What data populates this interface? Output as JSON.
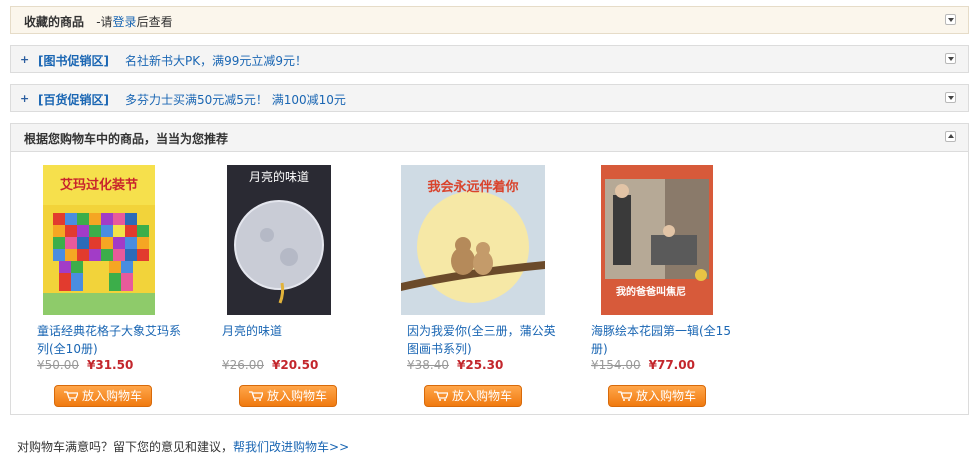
{
  "favorites": {
    "title": "收藏的商品",
    "prefix": "-请",
    "login_link": "登录",
    "suffix": "后查看"
  },
  "promos": [
    {
      "tag": "[图书促销区]",
      "text": "名社新书大PK，满99元立减9元！"
    },
    {
      "tag": "[百货促销区]",
      "text": "多芬力士买满50元减5元！ 满100减10元"
    }
  ],
  "recommend": {
    "title": "根据您购物车中的商品，当当为您推荐",
    "products": [
      {
        "name": "童话经典花格子大象艾玛系列(全10册)",
        "old_price": "¥50.00",
        "new_price": "¥31.50",
        "button": "放入购物车",
        "cover_title": "艾玛过化装节"
      },
      {
        "name": "月亮的味道",
        "old_price": "¥26.00",
        "new_price": "¥20.50",
        "button": "放入购物车",
        "cover_title": "月亮的味道"
      },
      {
        "name": "因为我爱你(全三册，蒲公英图画书系列)",
        "old_price": "¥38.40",
        "new_price": "¥25.30",
        "button": "放入购物车",
        "cover_title": "我会永远伴着你"
      },
      {
        "name": "海豚绘本花园第一辑(全15册)",
        "old_price": "¥154.00",
        "new_price": "¥77.00",
        "button": "放入购物车",
        "cover_title": "我的爸爸叫焦尼"
      }
    ]
  },
  "footer": {
    "text": "对购物车满意吗？留下您的意见和建议，",
    "link": "帮我们改进购物车>>"
  }
}
